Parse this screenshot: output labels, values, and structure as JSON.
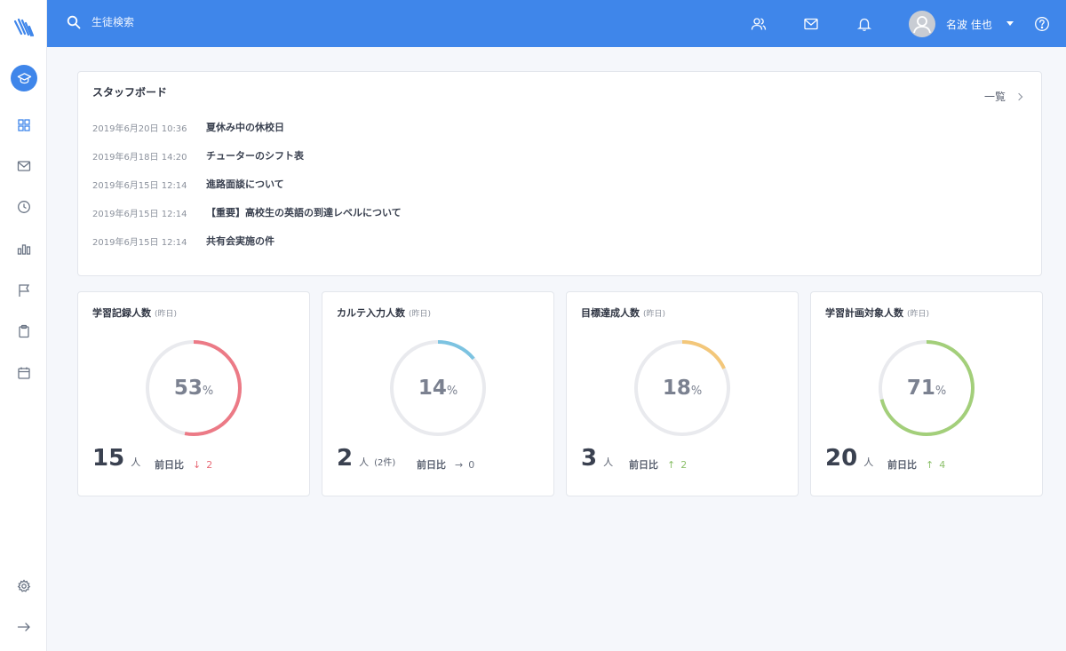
{
  "header": {
    "search_placeholder": "生徒検索",
    "user_name": "名波 佳也"
  },
  "sidebar": {
    "items": [
      {
        "icon": "graduation-cap-icon",
        "active": true
      },
      {
        "icon": "grid-icon"
      },
      {
        "icon": "mail-icon"
      },
      {
        "icon": "clock-icon"
      },
      {
        "icon": "bar-chart-icon"
      },
      {
        "icon": "flag-icon"
      },
      {
        "icon": "clipboard-icon"
      },
      {
        "icon": "calendar-icon"
      },
      {
        "icon": "settings-icon"
      },
      {
        "icon": "arrow-right-icon"
      }
    ]
  },
  "board": {
    "title": "スタッフボード",
    "more_label": "一覧",
    "items": [
      {
        "date": "2019年6月20日  10:36",
        "title": "夏休み中の休校日"
      },
      {
        "date": "2019年6月18日  14:20",
        "title": "チューターのシフト表"
      },
      {
        "date": "2019年6月15日  12:14",
        "title": "進路面談について"
      },
      {
        "date": "2019年6月15日  12:14",
        "title": "【重要】高校生の英語の到達レベルについて"
      },
      {
        "date": "2019年6月15日  12:14",
        "title": "共有会実施の件"
      }
    ]
  },
  "stats": [
    {
      "title": "学習記録人数",
      "sub": "(昨日)",
      "percent": 53,
      "pct_sign": "%",
      "color": "#ec7a86",
      "count": "15",
      "unit": "人",
      "extra": "",
      "compare_label": "前日比",
      "arrow": "↓",
      "delta": "2",
      "delta_color": "#e86b77"
    },
    {
      "title": "カルテ入力人数",
      "sub": "(昨日)",
      "percent": 14,
      "pct_sign": "%",
      "color": "#7cc3e1",
      "count": "2",
      "unit": "人",
      "extra": "(2件)",
      "compare_label": "前日比",
      "arrow": "→",
      "delta": "0",
      "delta_color": "#6b7280"
    },
    {
      "title": "目標達成人数",
      "sub": "(昨日)",
      "percent": 18,
      "pct_sign": "%",
      "color": "#f3c77a",
      "count": "3",
      "unit": "人",
      "extra": "",
      "compare_label": "前日比",
      "arrow": "↑",
      "delta": "2",
      "delta_color": "#8cc06a"
    },
    {
      "title": "学習計画対象人数",
      "sub": "(昨日)",
      "percent": 71,
      "pct_sign": "%",
      "color": "#a3cf7a",
      "count": "20",
      "unit": "人",
      "extra": "",
      "compare_label": "前日比",
      "arrow": "↑",
      "delta": "4",
      "delta_color": "#8cc06a"
    }
  ]
}
